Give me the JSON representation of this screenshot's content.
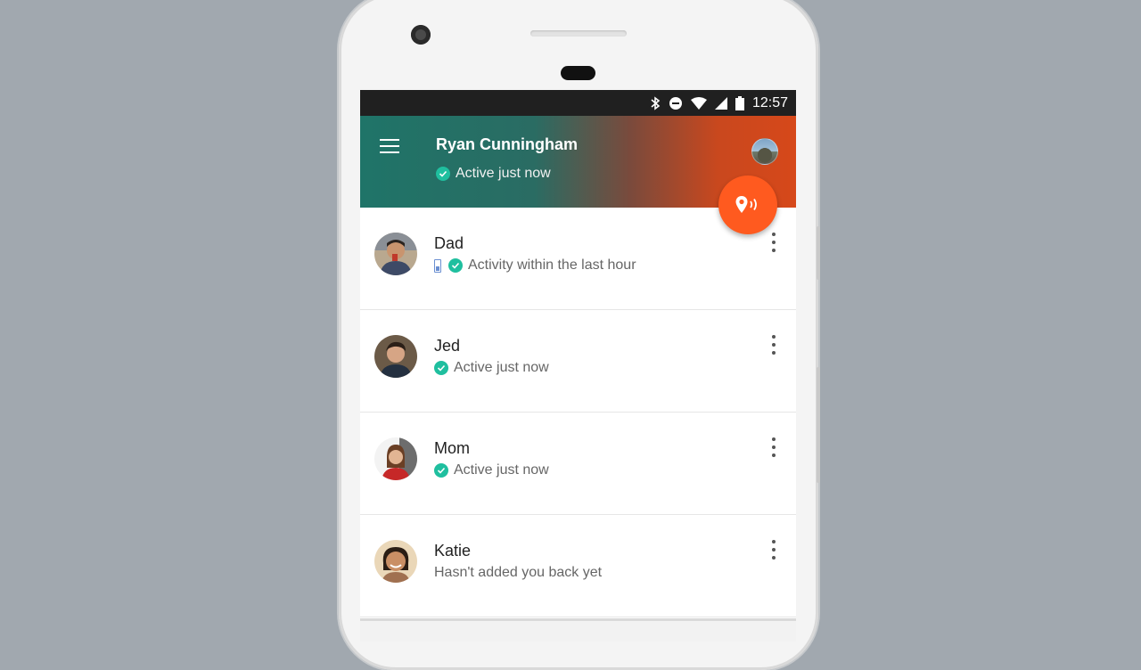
{
  "statusbar": {
    "time": "12:57",
    "icons": [
      "bluetooth-icon",
      "do-not-disturb-icon",
      "wifi-icon",
      "signal-icon",
      "battery-icon"
    ]
  },
  "header": {
    "user_name": "Ryan Cunningham",
    "user_status": "Active just now",
    "accent_start": "#1f7468",
    "accent_end": "#d6481a"
  },
  "fab": {
    "icon": "location-share-icon",
    "color": "#ff5a1f"
  },
  "contacts": [
    {
      "name": "Dad",
      "status": "Activity within the last hour",
      "battery": true,
      "active": true
    },
    {
      "name": "Jed",
      "status": "Active just now",
      "battery": false,
      "active": true
    },
    {
      "name": "Mom",
      "status": "Active just now",
      "battery": false,
      "active": true
    },
    {
      "name": "Katie",
      "status": "Hasn't added you back yet",
      "battery": false,
      "active": false
    }
  ],
  "colors": {
    "active_check": "#1fbf9f",
    "background": "#a1a8af"
  }
}
